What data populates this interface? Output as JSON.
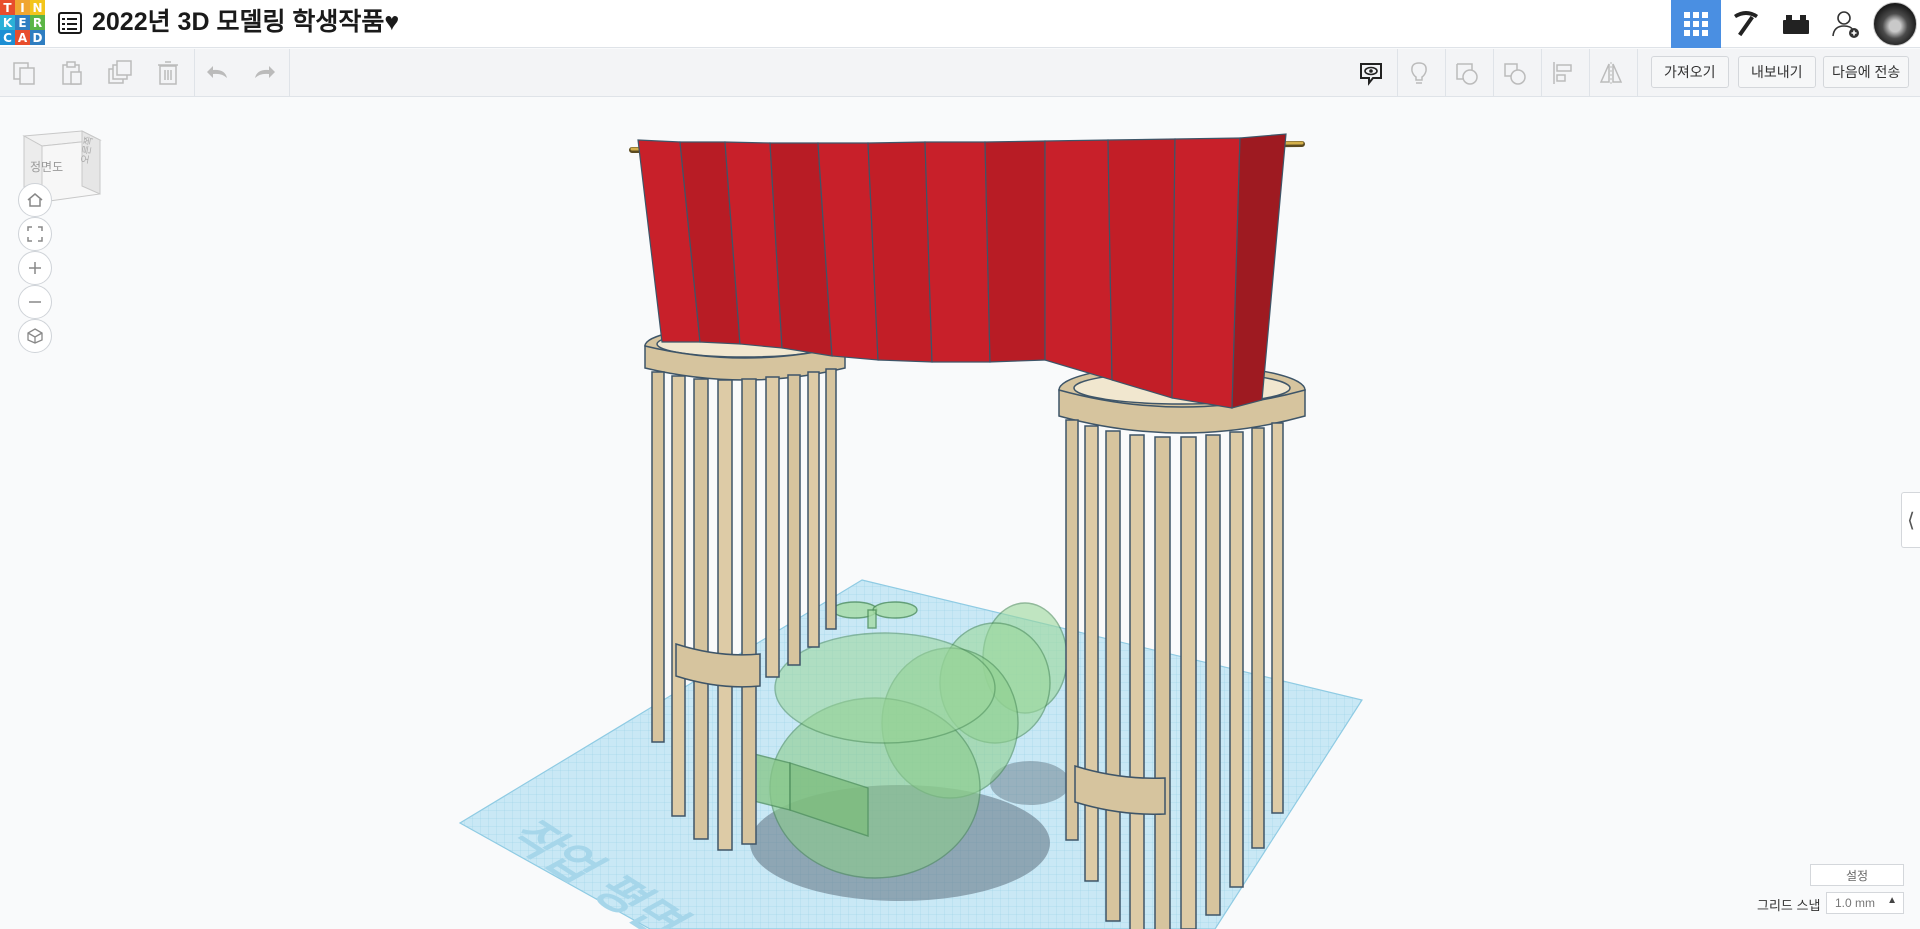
{
  "app": {
    "logo_letters": [
      "T",
      "I",
      "N",
      "K",
      "E",
      "R",
      "C",
      "A",
      "D"
    ],
    "logo_colors": [
      "#e84d2c",
      "#f0a531",
      "#f3c51b",
      "#2bb0d7",
      "#2f7ec1",
      "#5bb546",
      "#1d8fd4",
      "#e84d2c",
      "#2f7ec1"
    ],
    "title": "2022년 3D 모델링 학생작품♥"
  },
  "header": {
    "buttons": [
      {
        "name": "3d-design-view",
        "icon": "grid-icon",
        "active": true
      },
      {
        "name": "blocks-view",
        "icon": "pickaxe-icon",
        "active": false
      },
      {
        "name": "bricks-view",
        "icon": "brick-icon",
        "active": false
      },
      {
        "name": "invite-user",
        "icon": "add-user-icon",
        "active": false
      }
    ],
    "accent_color": "#4a8fe2"
  },
  "toolbar": {
    "import_label": "가져오기",
    "export_label": "내보내기",
    "send_to_label": "다음에 전송"
  },
  "viewport": {
    "view_cube_front": "정면도",
    "view_cube_right": "오른쪽",
    "view_cube_top": "평면",
    "workplane_label": "작업 평면"
  },
  "bottom": {
    "settings_label": "설정",
    "grid_snap_label": "그리드 스냅",
    "grid_snap_value": "1.0 mm"
  },
  "colors": {
    "curtain_red": "#c8202a",
    "pillar_tan": "#d8c8a0",
    "ghost_green": "#86cf86",
    "workplane_blue": "#bfe3f2"
  }
}
